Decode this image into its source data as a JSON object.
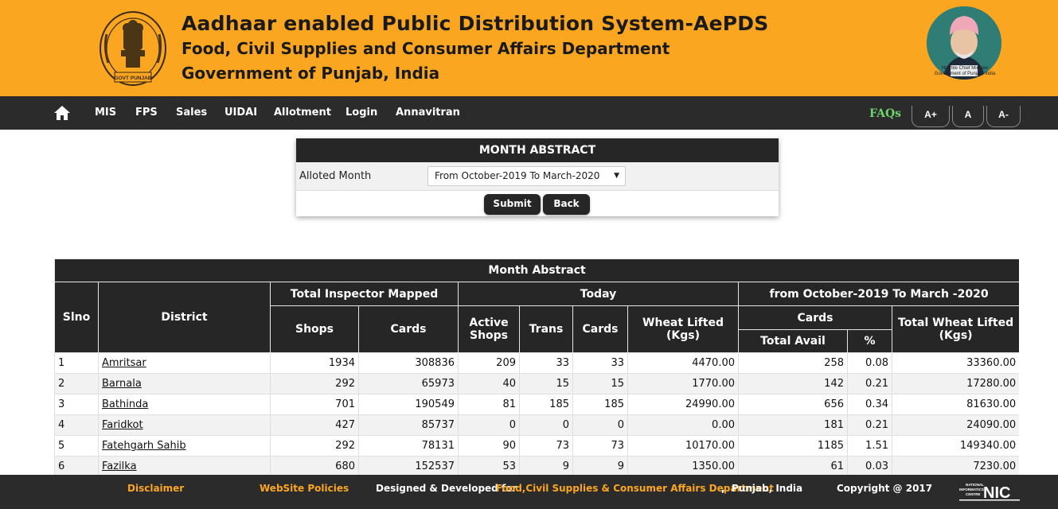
{
  "header": {
    "title": "Aadhaar enabled Public Distribution System-AePDS",
    "department": "Food, Civil Supplies and Consumer Affairs Department",
    "government": "Government of Punjab, India",
    "emblem_text": "GOVT PUNJAB",
    "cm_caption_1": "Hon'ble Chief Minister",
    "cm_caption_2": "Government of Punjab, India",
    "bg_color": "#fba620"
  },
  "nav": {
    "items": [
      "MIS",
      "FPS",
      "Sales",
      "UIDAI",
      "Allotment",
      "Login",
      "Annavitran"
    ],
    "faqs": "FAQs",
    "font_increase": "A+",
    "font_normal": "A",
    "font_decrease": "A-"
  },
  "form": {
    "title": "MONTH ABSTRACT",
    "label": "Alloted Month",
    "selected": "From October-2019 To March-2020",
    "submit": "Submit",
    "back": "Back"
  },
  "table": {
    "title": "Month Abstract",
    "headers": {
      "slno": "Slno",
      "district": "District",
      "inspector_group": "Total Inspector Mapped",
      "today_group": "Today",
      "period_group": "from October-2019 To March -2020",
      "shops": "Shops",
      "cards": "Cards",
      "active_shops": "Active Shops",
      "trans": "Trans",
      "today_cards": "Cards",
      "wheat_lifted": "Wheat Lifted (Kgs)",
      "period_cards": "Cards",
      "total_avail": "Total Avail",
      "percent": "%",
      "total_wheat": "Total Wheat Lifted (Kgs)"
    },
    "rows": [
      [
        "1",
        "Amritsar",
        "1934",
        "308836",
        "209",
        "33",
        "33",
        "4470.00",
        "258",
        "0.08",
        "33360.00"
      ],
      [
        "2",
        "Barnala",
        "292",
        "65973",
        "40",
        "15",
        "15",
        "1770.00",
        "142",
        "0.21",
        "17280.00"
      ],
      [
        "3",
        "Bathinda",
        "701",
        "190549",
        "81",
        "185",
        "185",
        "24990.00",
        "656",
        "0.34",
        "81630.00"
      ],
      [
        "4",
        "Faridkot",
        "427",
        "85737",
        "0",
        "0",
        "0",
        "0.00",
        "181",
        "0.21",
        "24090.00"
      ],
      [
        "5",
        "Fatehgarh Sahib",
        "292",
        "78131",
        "90",
        "73",
        "73",
        "10170.00",
        "1185",
        "1.51",
        "149340.00"
      ],
      [
        "6",
        "Fazilka",
        "680",
        "152537",
        "53",
        "9",
        "9",
        "1350.00",
        "61",
        "0.03",
        "7230.00"
      ]
    ]
  },
  "footer": {
    "disclaimer": "Disclaimer",
    "policies": "WebSite Policies",
    "designed_prefix": "Designed & Developed for",
    "designed_dept": "Food,Civil Supplies & Consumer Affairs Department",
    "designed_suffix": ",  Punjab, India",
    "copyright": "Copyright @ 2017",
    "nic_line1": "NATIONAL",
    "nic_line2": "INFORMATICS",
    "nic_line3": "CENTRE",
    "nic_logo": "NIC"
  }
}
